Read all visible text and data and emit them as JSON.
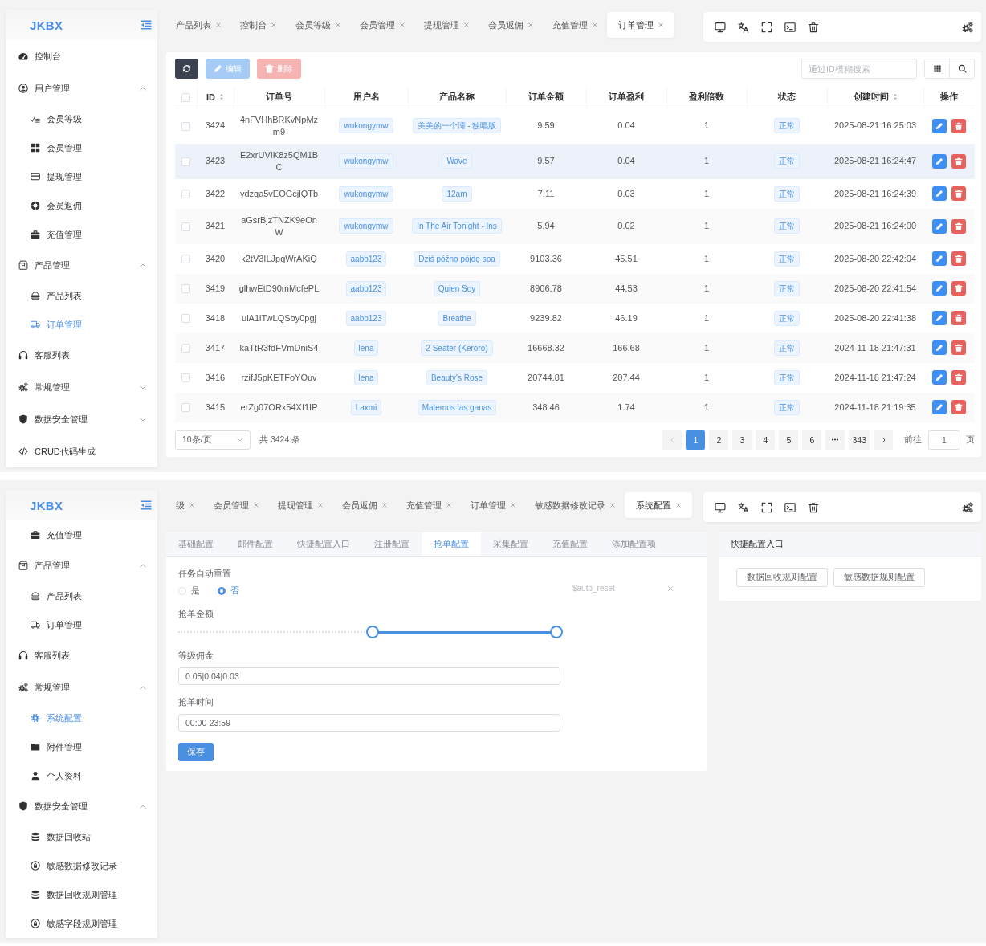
{
  "panels": [
    {
      "kind": "table",
      "sidebar": {
        "logo": "JKBX",
        "items": [
          {
            "label": "控制台",
            "selected": false
          },
          {
            "label": "用户管理",
            "selected": false,
            "expanded": true,
            "children": [
              {
                "label": "会员等级",
                "selected": false
              },
              {
                "label": "会员管理",
                "selected": false
              },
              {
                "label": "提现管理",
                "selected": false
              },
              {
                "label": "会员返佣",
                "selected": false
              },
              {
                "label": "充值管理",
                "selected": false
              }
            ]
          },
          {
            "label": "产品管理",
            "selected": false,
            "expanded": true,
            "children": [
              {
                "label": "产品列表",
                "selected": false
              },
              {
                "label": "订单管理",
                "selected": true
              }
            ]
          },
          {
            "label": "客服列表",
            "selected": false
          },
          {
            "label": "常规管理",
            "selected": false,
            "expanded": false
          },
          {
            "label": "数据安全管理",
            "selected": false,
            "expanded": false
          },
          {
            "label": "CRUD代码生成",
            "selected": false
          }
        ]
      },
      "tabs": [
        {
          "label": "产品列表",
          "selected": false
        },
        {
          "label": "控制台",
          "selected": false
        },
        {
          "label": "会员等级",
          "selected": false
        },
        {
          "label": "会员管理",
          "selected": false
        },
        {
          "label": "提现管理",
          "selected": false
        },
        {
          "label": "会员返佣",
          "selected": false
        },
        {
          "label": "充值管理",
          "selected": false
        },
        {
          "label": "订单管理",
          "selected": true
        }
      ],
      "table_view": {
        "buttons": [
          {
            "kind": "refresh",
            "disabled": false
          },
          {
            "kind": "edit",
            "label": "编辑",
            "disabled": true
          },
          {
            "kind": "delete",
            "label": "删除",
            "disabled": true
          }
        ],
        "search": {
          "placeholder": "通过ID模糊搜索"
        },
        "select_all": false,
        "columns": [
          {
            "label": "ID",
            "kind": "text",
            "sortable": true
          },
          {
            "label": "订单号",
            "kind": "text",
            "sortable": false
          },
          {
            "label": "用户名",
            "kind": "tag",
            "sortable": false
          },
          {
            "label": "产品名称",
            "kind": "tag",
            "sortable": false
          },
          {
            "label": "订单金额",
            "kind": "text",
            "sortable": false
          },
          {
            "label": "订单盈利",
            "kind": "text",
            "sortable": false
          },
          {
            "label": "盈利倍数",
            "kind": "text",
            "sortable": false
          },
          {
            "label": "状态",
            "kind": "tag",
            "sortable": false
          },
          {
            "label": "创建时间",
            "kind": "text",
            "sortable": true
          },
          {
            "label": "操作",
            "kind": "actions",
            "sortable": false
          }
        ],
        "rows": [
          {
            "checked": false,
            "highlighted": false,
            "cells": [
              "3424",
              "4nFVHhBRKvNpMzm9",
              "wukongymw",
              "美美的一个湾 - 独唱版",
              "9.59",
              "0.04",
              "1",
              "正常",
              "2025-08-21 16:25:03"
            ]
          },
          {
            "checked": false,
            "highlighted": true,
            "cells": [
              "3423",
              "E2xrUVIK8z5QM1BC",
              "wukongymw",
              "Wave",
              "9.57",
              "0.04",
              "1",
              "正常",
              "2025-08-21 16:24:47"
            ]
          },
          {
            "checked": false,
            "highlighted": false,
            "cells": [
              "3422",
              "ydzqa5vEOGcjlQTb",
              "wukongymw",
              "12am",
              "7.11",
              "0.03",
              "1",
              "正常",
              "2025-08-21 16:24:39"
            ]
          },
          {
            "checked": false,
            "highlighted": false,
            "cells": [
              "3421",
              "aGsrBjzTNZK9eOnW",
              "wukongymw",
              "In The Air Tonight - Ins",
              "5.94",
              "0.02",
              "1",
              "正常",
              "2025-08-21 16:24:00"
            ]
          },
          {
            "checked": false,
            "highlighted": false,
            "cells": [
              "3420",
              "k2tV3ILJpqWrAKiQ",
              "aabb123",
              "Dziś późno pójdę spa",
              "9103.36",
              "45.51",
              "1",
              "正常",
              "2025-08-20 22:42:04"
            ]
          },
          {
            "checked": false,
            "highlighted": false,
            "cells": [
              "3419",
              "glhwEtD90mMcfePL",
              "aabb123",
              "Quien Soy",
              "8906.78",
              "44.53",
              "1",
              "正常",
              "2025-08-20 22:41:54"
            ]
          },
          {
            "checked": false,
            "highlighted": false,
            "cells": [
              "3418",
              "ulA1iTwLQSby0pgj",
              "aabb123",
              "Breathe",
              "9239.82",
              "46.19",
              "1",
              "正常",
              "2025-08-20 22:41:38"
            ]
          },
          {
            "checked": false,
            "highlighted": false,
            "cells": [
              "3417",
              "kaTtR3fdFVmDniS4",
              "lena",
              "2 Seater (Keroro)",
              "16668.32",
              "166.68",
              "1",
              "正常",
              "2024-11-18 21:47:31"
            ]
          },
          {
            "checked": false,
            "highlighted": false,
            "cells": [
              "3416",
              "rzifJ5pKETFoYOuv",
              "lena",
              "Beauty's Rose",
              "20744.81",
              "207.44",
              "1",
              "正常",
              "2024-11-18 21:47:24"
            ]
          },
          {
            "checked": false,
            "highlighted": false,
            "cells": [
              "3415",
              "erZg07ORx54Xf1IP",
              "Laxmi",
              "Matemos las ganas",
              "348.46",
              "1.74",
              "1",
              "正常",
              "2024-11-18 21:19:35"
            ]
          }
        ],
        "pagination": {
          "page_size": "10条/页",
          "total": "共 3424 条",
          "prev": {
            "disabled": true
          },
          "next": {
            "disabled": false
          },
          "pages": [
            {
              "kind": "page",
              "label": "1",
              "selected": true
            },
            {
              "kind": "page",
              "label": "2",
              "selected": false
            },
            {
              "kind": "page",
              "label": "3",
              "selected": false
            },
            {
              "kind": "page",
              "label": "4",
              "selected": false
            },
            {
              "kind": "page",
              "label": "5",
              "selected": false
            },
            {
              "kind": "page",
              "label": "6",
              "selected": false
            },
            {
              "kind": "more",
              "selected": false
            },
            {
              "kind": "page",
              "label": "343",
              "selected": false
            }
          ],
          "jump": {
            "label": "前往",
            "value": "1",
            "suffix": "页"
          }
        }
      }
    },
    {
      "kind": "config",
      "sidebar": {
        "logo": "JKBX",
        "items": [
          {
            "children": [
              {
                "label": "充值管理",
                "selected": false
              }
            ]
          },
          {
            "label": "产品管理",
            "selected": false,
            "expanded": true,
            "children": [
              {
                "label": "产品列表",
                "selected": false
              },
              {
                "label": "订单管理",
                "selected": false
              }
            ]
          },
          {
            "label": "客服列表",
            "selected": false
          },
          {
            "label": "常规管理",
            "selected": false,
            "expanded": true,
            "children": [
              {
                "label": "系统配置",
                "selected": true
              },
              {
                "label": "附件管理",
                "selected": false
              },
              {
                "label": "个人资料",
                "selected": false
              }
            ]
          },
          {
            "label": "数据安全管理",
            "selected": false,
            "expanded": true,
            "children": [
              {
                "label": "数据回收站",
                "selected": false
              },
              {
                "label": "敏感数据修改记录",
                "selected": false
              },
              {
                "label": "数据回收规则管理",
                "selected": false
              },
              {
                "label": "敏感字段规则管理",
                "selected": false
              }
            ]
          }
        ]
      },
      "tabs": [
        {
          "label": "级",
          "selected": false
        },
        {
          "label": "会员管理",
          "selected": false
        },
        {
          "label": "提现管理",
          "selected": false
        },
        {
          "label": "会员返佣",
          "selected": false
        },
        {
          "label": "充值管理",
          "selected": false
        },
        {
          "label": "订单管理",
          "selected": false
        },
        {
          "label": "敏感数据修改记录",
          "selected": false
        },
        {
          "label": "系统配置",
          "selected": true
        }
      ],
      "config_view": {
        "tabs": [
          {
            "label": "基础配置",
            "selected": false
          },
          {
            "label": "邮件配置",
            "selected": false
          },
          {
            "label": "快捷配置入口",
            "selected": false
          },
          {
            "label": "注册配置",
            "selected": false
          },
          {
            "label": "抢单配置",
            "selected": true
          },
          {
            "label": "采集配置",
            "selected": false
          },
          {
            "label": "充值配置",
            "selected": false
          },
          {
            "label": "添加配置项",
            "selected": false
          }
        ],
        "fields": [
          {
            "kind": "radio",
            "label": "任务自动重置",
            "options": [
              {
                "label": "是",
                "selected": false
              },
              {
                "label": "否",
                "selected": true
              }
            ],
            "variable": "$auto_reset"
          },
          {
            "kind": "range",
            "label": "抢单金额",
            "thumbs": [
              {
                "level": 0.5
              },
              {
                "level": 0.99
              }
            ]
          },
          {
            "kind": "input",
            "label": "等级佣金",
            "value": "0.05|0.04|0.03"
          },
          {
            "kind": "input",
            "label": "抢单时间",
            "value": "00:00-23:59"
          }
        ],
        "submit": "保存"
      },
      "shortcuts": {
        "title": "快捷配置入口",
        "buttons": [
          {
            "label": "数据回收规则配置"
          },
          {
            "label": "敏感数据规则配置"
          }
        ]
      }
    }
  ]
}
